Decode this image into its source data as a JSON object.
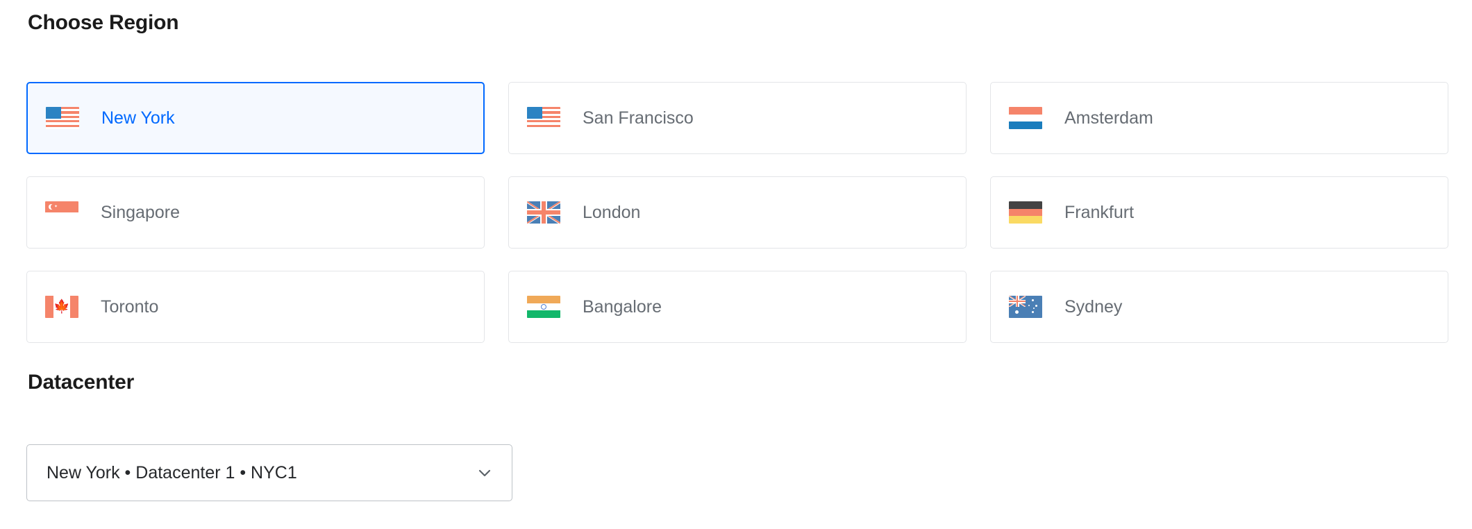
{
  "sections": {
    "region_heading": "Choose Region",
    "datacenter_heading": "Datacenter"
  },
  "colors": {
    "selected_border": "#0069ff",
    "selected_background": "#f5f9ff",
    "selected_text": "#0069ff",
    "card_border": "#e3e5e8",
    "card_text": "#666c73",
    "heading_text": "#1b1b1b",
    "select_border": "#bdc2c7",
    "select_text": "#26282b",
    "flag_accent": "#f5846a"
  },
  "regions": [
    {
      "label": "New York",
      "flag": "us-flag-icon",
      "selected": true
    },
    {
      "label": "San Francisco",
      "flag": "us-flag-icon",
      "selected": false
    },
    {
      "label": "Amsterdam",
      "flag": "nl-flag-icon",
      "selected": false
    },
    {
      "label": "Singapore",
      "flag": "sg-flag-icon",
      "selected": false
    },
    {
      "label": "London",
      "flag": "gb-flag-icon",
      "selected": false
    },
    {
      "label": "Frankfurt",
      "flag": "de-flag-icon",
      "selected": false
    },
    {
      "label": "Toronto",
      "flag": "ca-flag-icon",
      "selected": false
    },
    {
      "label": "Bangalore",
      "flag": "in-flag-icon",
      "selected": false
    },
    {
      "label": "Sydney",
      "flag": "au-flag-icon",
      "selected": false
    }
  ],
  "datacenter_select": {
    "value": "New York • Datacenter 1 • NYC1",
    "chevron_icon": "chevron-down-icon"
  }
}
